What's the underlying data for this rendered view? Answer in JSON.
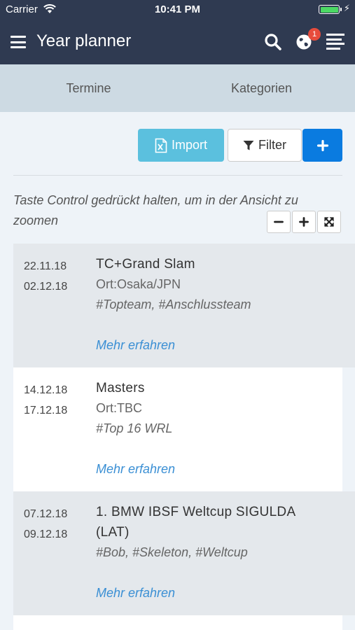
{
  "status_bar": {
    "carrier": "Carrier",
    "time": "10:41 PM",
    "battery_color": "#4cd964"
  },
  "navbar": {
    "title": "Year planner",
    "background_color": "#2f3a51",
    "notification_count": "1",
    "icons": [
      "menu-icon",
      "search-icon",
      "globe-icon",
      "list-icon"
    ]
  },
  "tabs": [
    {
      "label": "Termine"
    },
    {
      "label": "Kategorien"
    }
  ],
  "toolbar": {
    "import_label": "Import",
    "filter_label": "Filter",
    "import_color": "#5bc0de",
    "add_color": "#0a7be0"
  },
  "hint": "Taste Control gedrückt halten, um in der Ansicht zu zoomen",
  "events": [
    {
      "start": "22.11.18",
      "end": "02.12.18",
      "name": "TC+Grand Slam",
      "ort": "Ort:Osaka/JPN",
      "tags": "#Topteam, #Anschlussteam",
      "more": "Mehr erfahren"
    },
    {
      "start": "14.12.18",
      "end": "17.12.18",
      "name": "Masters",
      "ort": "Ort:TBC",
      "tags": "#Top 16 WRL",
      "more": "Mehr erfahren"
    },
    {
      "start": "07.12.18",
      "end": "09.12.18",
      "name": "1. BMW IBSF Weltcup SIGULDA (LAT)",
      "ort": "",
      "tags": "#Bob, #Skeleton, #Weltcup",
      "more": "Mehr erfahren"
    }
  ]
}
